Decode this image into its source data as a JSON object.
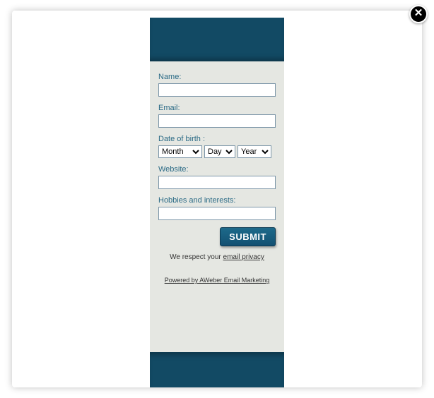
{
  "close_label": "✕",
  "fields": {
    "name": {
      "label": "Name:",
      "value": ""
    },
    "email": {
      "label": "Email:",
      "value": ""
    },
    "dob": {
      "label": "Date of birth :",
      "month": "Month",
      "day": "Day",
      "year": "Year"
    },
    "website": {
      "label": "Website:",
      "value": ""
    },
    "hobbies": {
      "label": "Hobbies and interests:",
      "value": ""
    }
  },
  "submit_label": "SUBMIT",
  "privacy_prefix": "We respect your ",
  "privacy_link": "email privacy",
  "powered_text": "Powered by AWeber Email Marketing"
}
